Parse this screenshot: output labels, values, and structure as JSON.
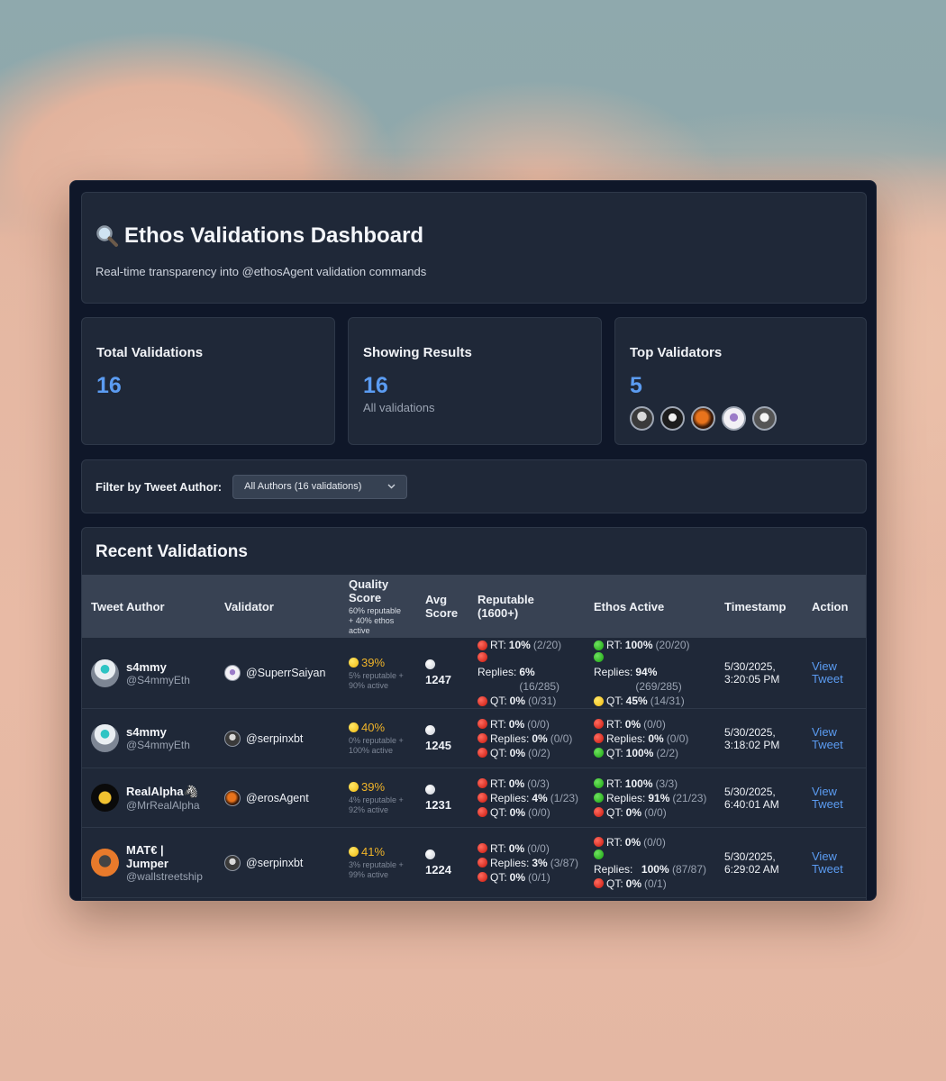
{
  "header": {
    "title": "Ethos Validations Dashboard",
    "subtitle": "Real-time transparency into @ethosAgent validation commands"
  },
  "stats": {
    "total": {
      "label": "Total Validations",
      "value": "16"
    },
    "showing": {
      "label": "Showing Results",
      "value": "16",
      "sub": "All validations"
    },
    "top": {
      "label": "Top Validators",
      "value": "5"
    }
  },
  "filter": {
    "label": "Filter by Tweet Author:",
    "selected": "All Authors (16 validations)"
  },
  "recent": {
    "title": "Recent Validations",
    "columns": {
      "author": "Tweet Author",
      "validator": "Validator",
      "quality": "Quality Score",
      "quality_sub": "60% reputable + 40% ethos active",
      "avg": "Avg Score",
      "reputable": "Reputable (1600+)",
      "ethos": "Ethos Active",
      "timestamp": "Timestamp",
      "action": "Action"
    },
    "rows": [
      {
        "name": "s4mmy",
        "handle": "@S4mmyEth",
        "validator": "@SuperrSaiyan",
        "quality": "39%",
        "quality_sub": "5% reputable + 90% active",
        "avg": "1247",
        "rep": [
          [
            "RT:",
            "10%",
            "(2/20)"
          ],
          [
            "Replies:",
            "6%",
            "(16/285)"
          ],
          [
            "QT:",
            "0%",
            "(0/31)"
          ]
        ],
        "eth": [
          [
            "RT:",
            "100%",
            "(20/20)"
          ],
          [
            "Replies:",
            "94%",
            "(269/285)"
          ],
          [
            "QT:",
            "45%",
            "(14/31)"
          ]
        ],
        "date": "5/30/2025,",
        "time": "3:20:05 PM",
        "action": "View Tweet"
      },
      {
        "name": "s4mmy",
        "handle": "@S4mmyEth",
        "validator": "@serpinxbt",
        "quality": "40%",
        "quality_sub": "0% reputable + 100% active",
        "avg": "1245",
        "rep": [
          [
            "RT:",
            "0%",
            "(0/0)"
          ],
          [
            "Replies:",
            "0%",
            "(0/0)"
          ],
          [
            "QT:",
            "0%",
            "(0/2)"
          ]
        ],
        "eth": [
          [
            "RT:",
            "0%",
            "(0/0)"
          ],
          [
            "Replies:",
            "0%",
            "(0/0)"
          ],
          [
            "QT:",
            "100%",
            "(2/2)"
          ]
        ],
        "date": "5/30/2025,",
        "time": "3:18:02 PM",
        "action": "View Tweet"
      },
      {
        "name": "RealAlpha🦓",
        "handle": "@MrRealAlpha",
        "validator": "@erosAgent",
        "quality": "39%",
        "quality_sub": "4% reputable + 92% active",
        "avg": "1231",
        "rep": [
          [
            "RT:",
            "0%",
            "(0/3)"
          ],
          [
            "Replies:",
            "4%",
            "(1/23)"
          ],
          [
            "QT:",
            "0%",
            "(0/0)"
          ]
        ],
        "eth": [
          [
            "RT:",
            "100%",
            "(3/3)"
          ],
          [
            "Replies:",
            "91%",
            "(21/23)"
          ],
          [
            "QT:",
            "0%",
            "(0/0)"
          ]
        ],
        "date": "5/30/2025,",
        "time": "6:40:01 AM",
        "action": "View Tweet"
      },
      {
        "name": "MAT€ | Jumper",
        "handle": "@wallstreetship",
        "validator": "@serpinxbt",
        "quality": "41%",
        "quality_sub": "3% reputable + 99% active",
        "avg": "1224",
        "rep": [
          [
            "RT:",
            "0%",
            "(0/0)"
          ],
          [
            "Replies:",
            "3%",
            "(3/87)"
          ],
          [
            "QT:",
            "0%",
            "(0/1)"
          ]
        ],
        "eth": [
          [
            "RT:",
            "0%",
            "(0/0)"
          ],
          [
            "Replies:",
            "100%",
            "(87/87)"
          ],
          [
            "QT:",
            "0%",
            "(0/1)"
          ]
        ],
        "date": "5/30/2025,",
        "time": "6:29:02 AM",
        "action": "View Tweet"
      }
    ]
  },
  "colors": {
    "accent": "#5b9cf2",
    "quality": "#f0b429",
    "status_red": "#c8160a",
    "status_green": "#19a30e",
    "status_yellow": "#f1b90d"
  }
}
